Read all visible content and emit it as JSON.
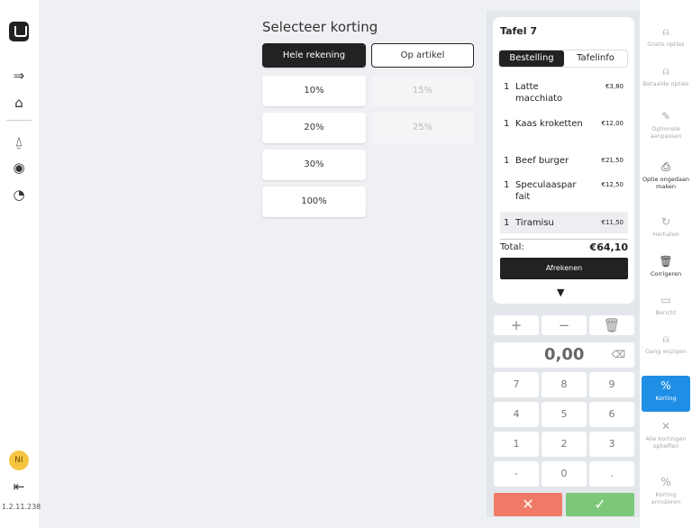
{
  "leftnav": {
    "icons": [
      "logout-arrow-icon",
      "home-icon",
      "bell-icon",
      "eye-icon",
      "pie-chart-icon"
    ],
    "avatar_initials": "NI",
    "version": "1.2.11.238"
  },
  "discount": {
    "title": "Selecteer korting",
    "mode_whole": "Hele rekening",
    "mode_item": "Op artikel",
    "options": [
      "10%",
      "20%",
      "30%",
      "100%"
    ],
    "disabled_options": [
      "15%",
      "25%"
    ]
  },
  "order": {
    "table": "Tafel 7",
    "tab_order": "Bestelling",
    "tab_info": "Tafelinfo",
    "items": [
      {
        "qty": "1",
        "name": "Latte macchiato",
        "price": "€3,80"
      },
      {
        "qty": "1",
        "name": "Kaas kroketten",
        "price": "€12,00"
      },
      {
        "qty": "1",
        "name": "Beef burger",
        "price": "€21,50"
      },
      {
        "qty": "1",
        "name": "Speculaasparfait",
        "price": "€12,50"
      },
      {
        "qty": "1",
        "name": "Tiramisu",
        "price": "€11,50"
      }
    ],
    "total_label": "Total:",
    "total_value": "€64,10",
    "checkout": "Afrekenen"
  },
  "keypad": {
    "display": "0,00",
    "keys": [
      "7",
      "8",
      "9",
      "4",
      "5",
      "6",
      "1",
      "2",
      "3",
      "-",
      "0",
      "."
    ]
  },
  "actions": [
    {
      "label": "Gratis opties",
      "icon": "bell-service-icon"
    },
    {
      "label": "Betaalde opties",
      "icon": "bell-service-icon"
    },
    {
      "label": "Optionele aanpassen",
      "icon": "edit-icon"
    },
    {
      "label": "Optie ongedaan maken",
      "icon": "undo-option-icon"
    },
    {
      "label": "Herhalen",
      "icon": "repeat-icon"
    },
    {
      "label": "Corrigeren",
      "icon": "trash-icon"
    },
    {
      "label": "Bericht",
      "icon": "message-icon"
    },
    {
      "label": "Gang wijzigen",
      "icon": "course-icon"
    },
    {
      "label": "Korting",
      "icon": "percent-icon"
    },
    {
      "label": "Alle kortingen opheffen",
      "icon": "close-icon"
    },
    {
      "label": "Korting annuleren",
      "icon": "percent-icon"
    }
  ],
  "colors": {
    "accent": "#1f8fe6",
    "cancel": "#ef7a66",
    "confirm": "#7cc87a",
    "dark": "#222222"
  }
}
